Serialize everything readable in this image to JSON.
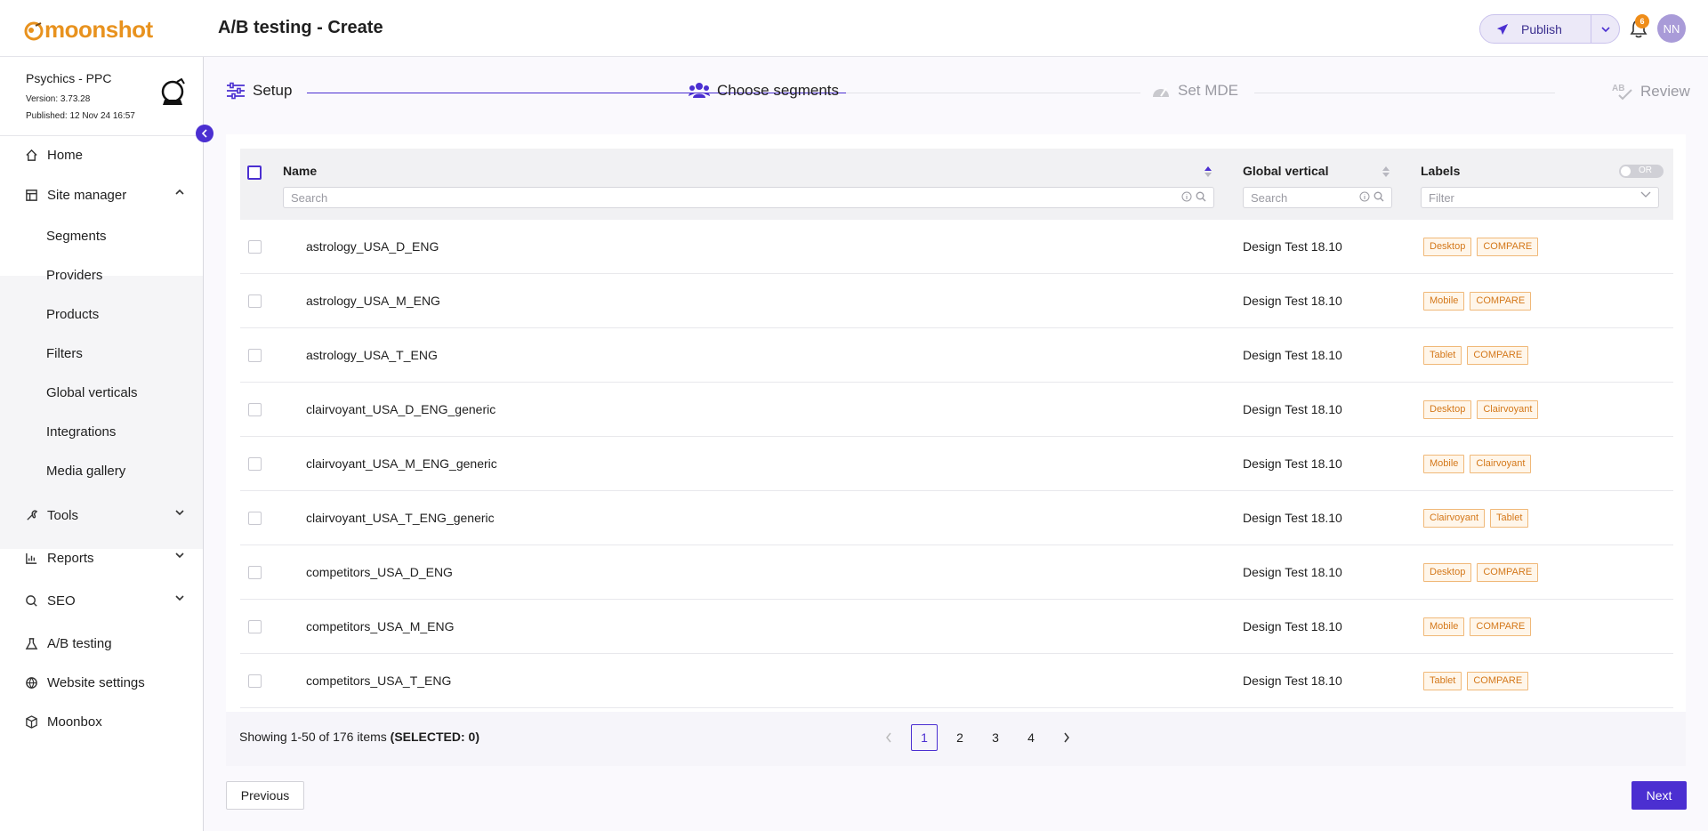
{
  "app": {
    "logo_text": "moonshot",
    "page_title": "A/B testing - Create",
    "publish_label": "Publish",
    "notification_count": "6",
    "avatar_initials": "NN",
    "accent_color": "#4b2fd1",
    "brand_color": "#e8921e"
  },
  "site": {
    "name": "Psychics - PPC",
    "version": "Version: 3.73.28",
    "published": "Published: 12 Nov 24 16:57"
  },
  "sidebar": {
    "items": [
      {
        "label": "Home",
        "icon": "home-icon"
      },
      {
        "label": "Site manager",
        "icon": "site-manager-icon",
        "expanded": true
      },
      {
        "label": "Tools",
        "icon": "wrench-icon",
        "expanded": false
      },
      {
        "label": "Reports",
        "icon": "chart-icon",
        "expanded": false
      },
      {
        "label": "SEO",
        "icon": "search-globe-icon",
        "expanded": false
      },
      {
        "label": "A/B testing",
        "icon": "flask-icon"
      },
      {
        "label": "Website settings",
        "icon": "globe-icon"
      },
      {
        "label": "Moonbox",
        "icon": "box-icon"
      }
    ],
    "sub_items": [
      "Segments",
      "Providers",
      "Products",
      "Filters",
      "Global verticals",
      "Integrations",
      "Media gallery"
    ]
  },
  "steps": [
    {
      "label": "Setup",
      "state": "done"
    },
    {
      "label": "Choose segments",
      "state": "active"
    },
    {
      "label": "Set MDE",
      "state": "pending"
    },
    {
      "label": "Review",
      "state": "pending"
    }
  ],
  "table": {
    "columns": {
      "name": "Name",
      "global_vertical": "Global vertical",
      "labels": "Labels"
    },
    "search_placeholder": "Search",
    "gv_search_placeholder": "Search",
    "labels_filter_placeholder": "Filter",
    "or_toggle_label": "OR",
    "rows": [
      {
        "name": "astrology_USA_D_ENG",
        "global_vertical": "Design Test 18.10",
        "labels": [
          "Desktop",
          "COMPARE"
        ]
      },
      {
        "name": "astrology_USA_M_ENG",
        "global_vertical": "Design Test 18.10",
        "labels": [
          "Mobile",
          "COMPARE"
        ]
      },
      {
        "name": "astrology_USA_T_ENG",
        "global_vertical": "Design Test 18.10",
        "labels": [
          "Tablet",
          "COMPARE"
        ]
      },
      {
        "name": "clairvoyant_USA_D_ENG_generic",
        "global_vertical": "Design Test 18.10",
        "labels": [
          "Desktop",
          "Clairvoyant"
        ]
      },
      {
        "name": "clairvoyant_USA_M_ENG_generic",
        "global_vertical": "Design Test 18.10",
        "labels": [
          "Mobile",
          "Clairvoyant"
        ]
      },
      {
        "name": "clairvoyant_USA_T_ENG_generic",
        "global_vertical": "Design Test 18.10",
        "labels": [
          "Clairvoyant",
          "Tablet"
        ]
      },
      {
        "name": "competitors_USA_D_ENG",
        "global_vertical": "Design Test 18.10",
        "labels": [
          "Desktop",
          "COMPARE"
        ]
      },
      {
        "name": "competitors_USA_M_ENG",
        "global_vertical": "Design Test 18.10",
        "labels": [
          "Mobile",
          "COMPARE"
        ]
      },
      {
        "name": "competitors_USA_T_ENG",
        "global_vertical": "Design Test 18.10",
        "labels": [
          "Tablet",
          "COMPARE"
        ]
      }
    ]
  },
  "footer": {
    "showing": "Showing 1-50 of 176 items",
    "selected": "(SELECTED: 0)",
    "pages": [
      "1",
      "2",
      "3",
      "4"
    ],
    "current_page": "1",
    "prev_label": "Previous",
    "next_label": "Next"
  }
}
